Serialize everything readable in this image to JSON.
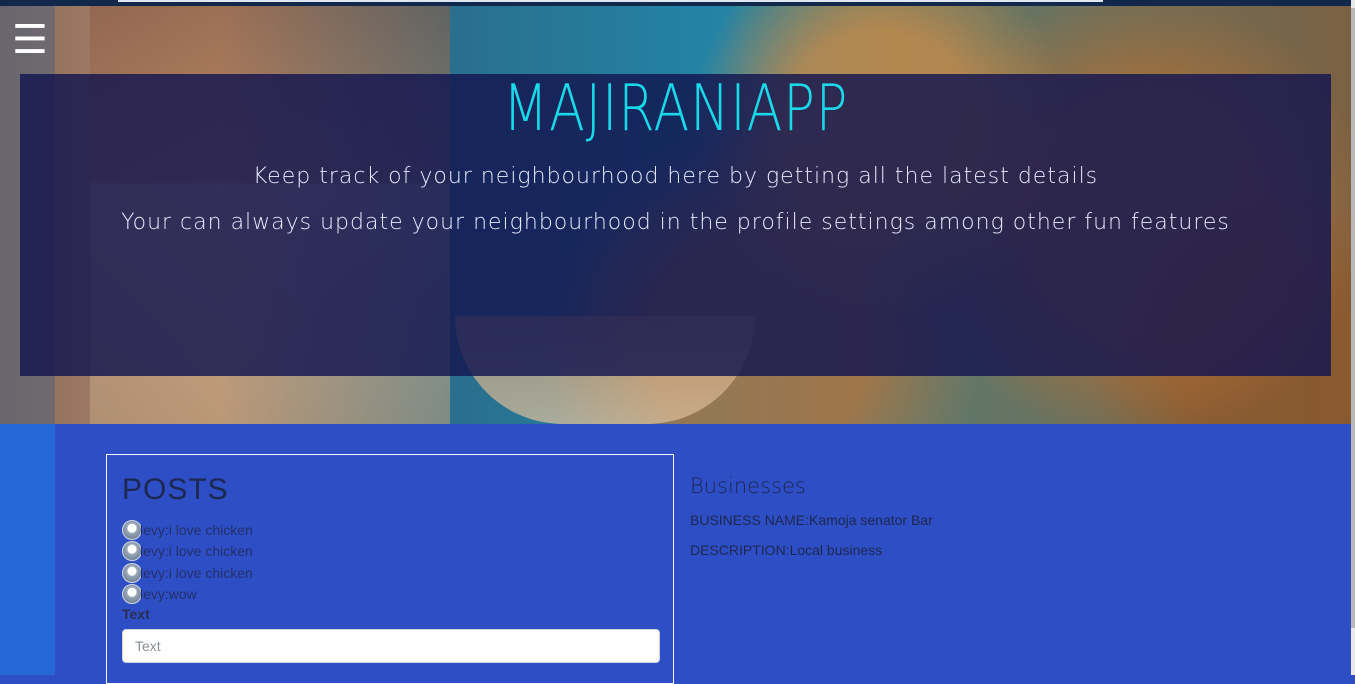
{
  "nav": {
    "menu_icon": "☰"
  },
  "hero": {
    "title": "MAJIRANIAPP",
    "tagline_1": "Keep track of your neighbourhood here by getting all the latest details",
    "tagline_2": "Your can always update your neighbourhood in the profile settings among other fun features"
  },
  "posts": {
    "heading": "POSTS",
    "items": [
      {
        "text": "levy:i love chicken"
      },
      {
        "text": "levy:i love chicken"
      },
      {
        "text": "levy:i love chicken"
      },
      {
        "text": "levy:wow"
      }
    ],
    "text_label": "Text",
    "text_placeholder": "Text"
  },
  "businesses": {
    "heading": "Businesses",
    "name_line": "BUSINESS NAME:Kamoja senator Bar",
    "description_line": "DESCRIPTION:Local business"
  },
  "colors": {
    "page_bg": "#2d4ec5",
    "title_cyan": "#19d8e8",
    "overlay": "#12154f"
  }
}
